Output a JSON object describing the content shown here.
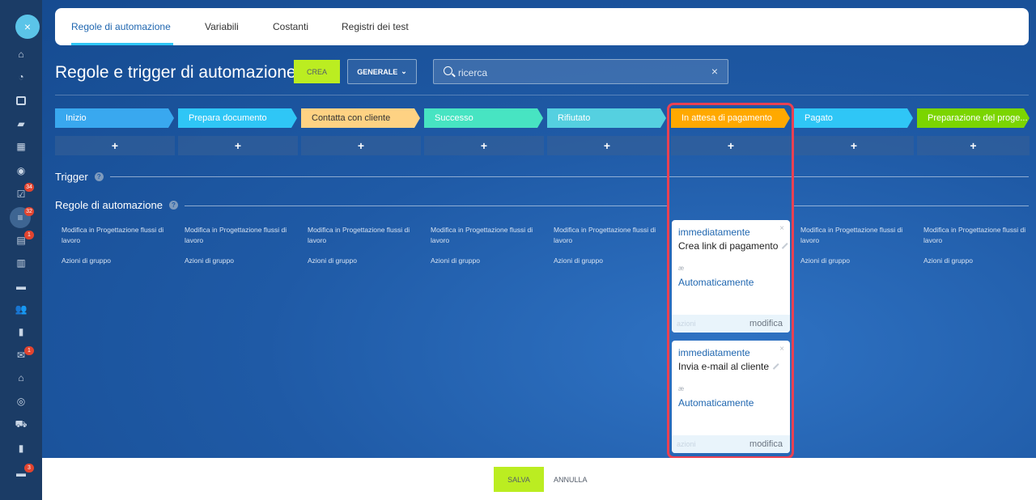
{
  "sidebar": {
    "close_label": "×",
    "badges": [
      "34",
      "32",
      "1",
      "1",
      "3"
    ]
  },
  "tabs": [
    "Regole di automazione",
    "Variabili",
    "Costanti",
    "Registri dei test"
  ],
  "header": {
    "title": "Regole e trigger di automazione",
    "create_label": "CREA",
    "general_label": "GENERALE",
    "search_placeholder": "ricerca",
    "clear_label": "×"
  },
  "stages": [
    {
      "label": "Inizio",
      "color": "#39a8ef"
    },
    {
      "label": "Prepara documento",
      "color": "#2fc6f6"
    },
    {
      "label": "Contatta con cliente",
      "color": "#fed283"
    },
    {
      "label": "Successo",
      "color": "#47e4c2"
    },
    {
      "label": "Rifiutato",
      "color": "#55d0e0"
    },
    {
      "label": "In attesa di pagamento",
      "color": "#ffa900"
    },
    {
      "label": "Pagato",
      "color": "#2fc6f6"
    },
    {
      "label": "Preparazione del proge...",
      "color": "#7bd500"
    }
  ],
  "add_label": "+",
  "sections": {
    "trigger": "Trigger",
    "rules": "Regole di automazione",
    "help": "?"
  },
  "column_texts": {
    "modify": "Modifica in Progettazione flussi di lavoro",
    "group_actions": "Azioni di gruppo"
  },
  "cards": [
    {
      "timing": "immediatamente",
      "title": "Crea link di pagamento",
      "small": "æ",
      "mode": "Automaticamente",
      "actions": "azioni",
      "edit": "modifica",
      "close": "×"
    },
    {
      "timing": "immediatamente",
      "title": "Invia e-mail al cliente",
      "small": "æ",
      "mode": "Automaticamente",
      "actions": "azioni",
      "edit": "modifica",
      "close": "×"
    }
  ],
  "footer": {
    "save_label": "SALVA",
    "cancel_label": "ANNULLA"
  }
}
